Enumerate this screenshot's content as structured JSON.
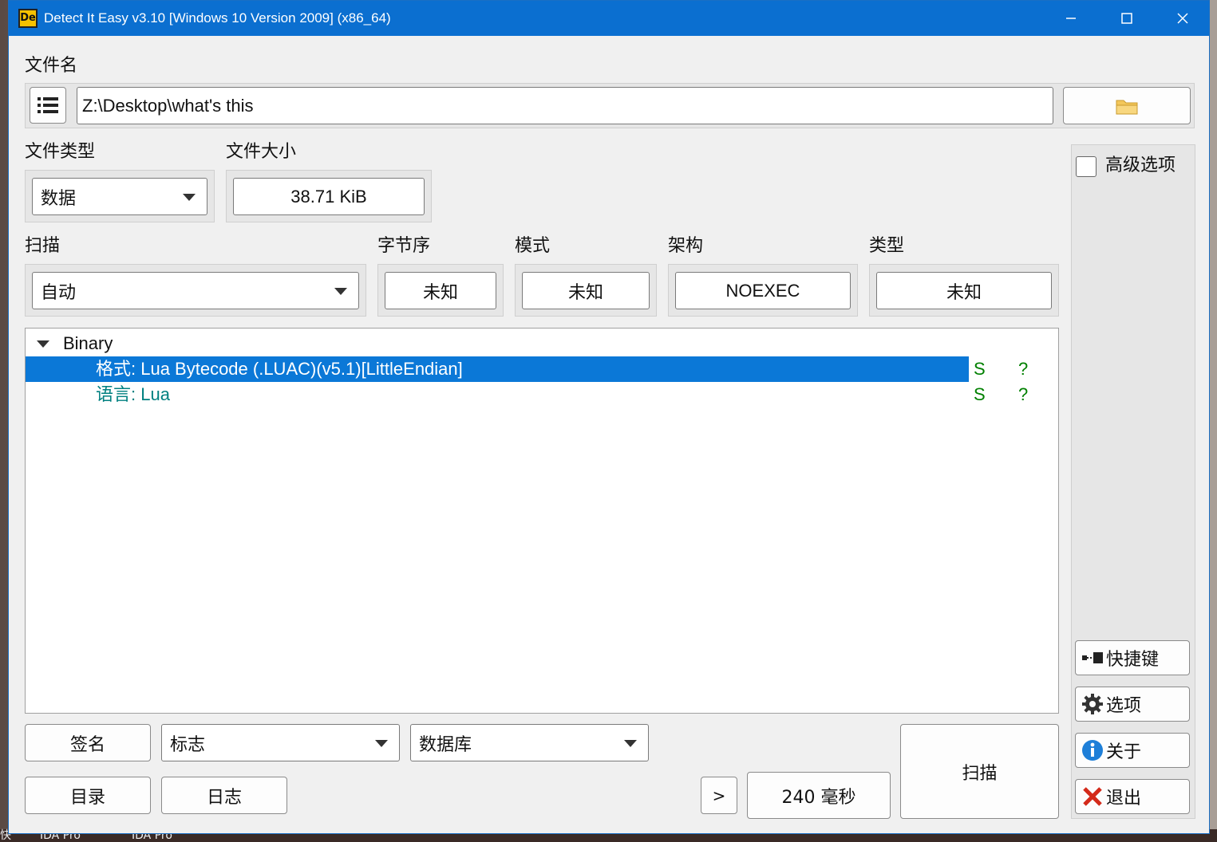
{
  "window": {
    "title": "Detect It Easy v3.10 [Windows 10 Version 2009] (x86_64)",
    "app_icon_text": "De"
  },
  "file": {
    "label": "文件名",
    "path": "Z:\\Desktop\\what's this"
  },
  "file_type": {
    "label": "文件类型",
    "selected": "数据"
  },
  "file_size": {
    "label": "文件大小",
    "value": "38.71 KiB"
  },
  "scan_mode": {
    "label": "扫描",
    "selected": "自动"
  },
  "endianness": {
    "label": "字节序",
    "value": "未知"
  },
  "mode": {
    "label": "模式",
    "value": "未知"
  },
  "arch": {
    "label": "架构",
    "value": "NOEXEC"
  },
  "type": {
    "label": "类型",
    "value": "未知"
  },
  "results": {
    "root_label": "Binary",
    "rows": [
      {
        "text": "格式: Lua Bytecode (.LUAC)(v5.1)[LittleEndian]",
        "flag_s": "S",
        "flag_q": "?",
        "selected": true
      },
      {
        "text": "语言: Lua",
        "flag_s": "S",
        "flag_q": "?",
        "selected": false
      }
    ]
  },
  "bottom": {
    "signatures_label": "签名",
    "flags_selected": "标志",
    "database_selected": "数据库",
    "directory_label": "目录",
    "log_label": "日志",
    "more_label": ">",
    "elapsed": "240 毫秒",
    "scan_label": "扫描"
  },
  "right_panel": {
    "advanced_label": "高级选项",
    "shortcuts_label": "快捷键",
    "options_label": "选项",
    "about_label": "关于",
    "exit_label": "退出"
  },
  "taskbar": {
    "items": [
      "快",
      "IDA Pro",
      "IDA Pro"
    ]
  },
  "colors": {
    "accent": "#0b78d7",
    "titlebar": "#0b6fd0",
    "tree_text": "#008080",
    "flag_green": "#008000"
  }
}
